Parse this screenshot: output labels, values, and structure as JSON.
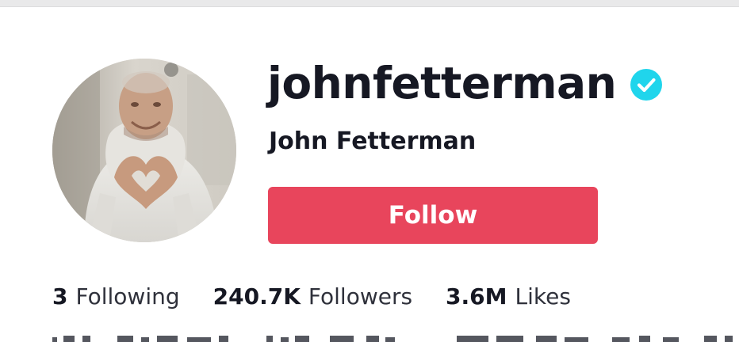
{
  "profile": {
    "username": "johnfetterman",
    "display_name": "John Fetterman",
    "verified_icon": "verified-badge-icon",
    "avatar_icon": "profile-photo",
    "follow_label": "Follow"
  },
  "stats": [
    {
      "value": "3",
      "label": "Following"
    },
    {
      "value": "240.7K",
      "label": "Followers"
    },
    {
      "value": "3.6M",
      "label": "Likes"
    }
  ],
  "colors": {
    "accent": "#e8455c",
    "verified": "#20d5ec",
    "text_primary": "#161823",
    "text_secondary": "#2f313b"
  }
}
